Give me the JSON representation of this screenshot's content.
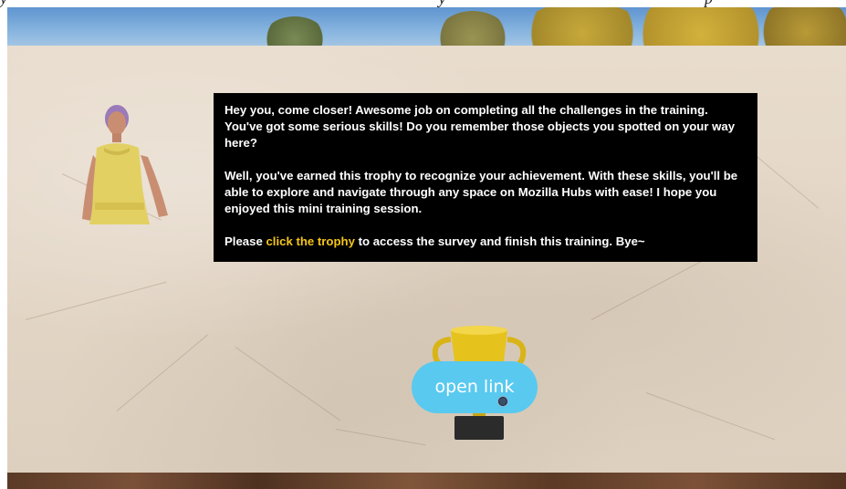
{
  "top_caption": "y · · · · · · · · · · · · · · · · · · · · · · · · · · · · · · · · · · · · · · · · · · · · · · · · · · · · y · · · · · · · · · · · · · · · · · · · · · · · · · · · · · · · p",
  "scene": {
    "avatar_icon": "woman-avatar-icon",
    "trophy_icon": "trophy-icon"
  },
  "dialog": {
    "paragraph1": "Hey you, come closer! Awesome job on completing all the challenges in the training. You've got some serious skills! Do you remember those objects you spotted on your way here?",
    "paragraph2": "Well, you've earned this trophy to recognize your achievement. With these skills, you'll be able to explore and navigate through any space on Mozilla Hubs with ease! I hope you enjoyed this mini training session.",
    "paragraph3_prefix": "Please ",
    "paragraph3_link": "click the trophy",
    "paragraph3_suffix": " to access the survey and finish this training. Bye~"
  },
  "open_link_button": {
    "label": "open link"
  },
  "colors": {
    "dialog_background": "#000000",
    "dialog_text": "#ffffff",
    "highlight": "#f5c518",
    "button_background": "#59c9ef",
    "button_text": "#ffffff"
  }
}
